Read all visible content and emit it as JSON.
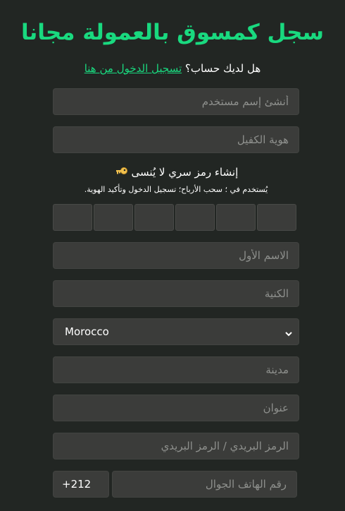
{
  "header": {
    "title": "سجل كمسوق بالعمولة مجانا",
    "login_question": "هل لديك حساب؟",
    "login_link": "تسجيل الدخول من هنا"
  },
  "form": {
    "username_placeholder": "أنشئ إسم مستخدم",
    "sponsor_placeholder": "هوية الكفيل",
    "pin": {
      "heading": "إنشاء رمز سري لا يُنسى",
      "help": "يُستخدم في ؛ سحب الأرباح؛ تسجيل الدخول وتأكيد الهوية.",
      "digits": 6,
      "icon": "key-icon"
    },
    "first_name_placeholder": "الاسم الأول",
    "last_name_placeholder": "الكنية",
    "country": {
      "selected": "Morocco",
      "icon": "chevron-down-icon"
    },
    "city_placeholder": "مدينة",
    "address_placeholder": "عنوان",
    "postal_placeholder": "الرمز البريدي / الرمز البريدي",
    "phone_code": "+212",
    "phone_placeholder": "رقم الهاتف الجوال"
  },
  "colors": {
    "accent": "#19d97f",
    "background": "#222623",
    "field": "#3b3c3a"
  }
}
